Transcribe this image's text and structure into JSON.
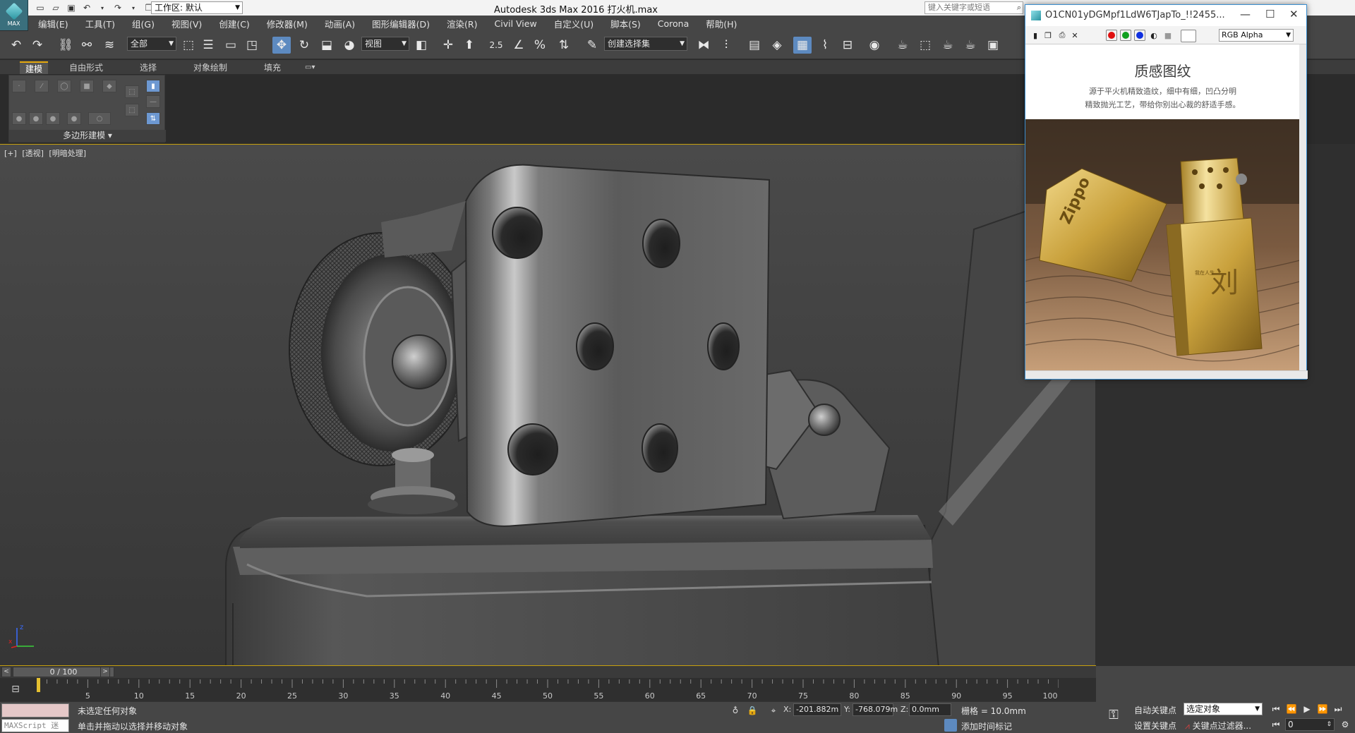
{
  "titlebar": {
    "app_logo_text": "MAX",
    "workspace": "工作区: 默认",
    "title": "Autodesk 3ds Max 2016      打火机.max",
    "search_placeholder": "键入关键字或短语"
  },
  "menu": [
    "编辑(E)",
    "工具(T)",
    "组(G)",
    "视图(V)",
    "创建(C)",
    "修改器(M)",
    "动画(A)",
    "图形编辑器(D)",
    "渲染(R)",
    "Civil View",
    "自定义(U)",
    "脚本(S)",
    "Corona",
    "帮助(H)"
  ],
  "toolbar": {
    "selection_filter": "全部",
    "ref_coord": "视图",
    "snap_angle_label": "2.5",
    "named_selection": "创建选择集"
  },
  "ribbon": {
    "tabs": [
      "建模",
      "自由形式",
      "选择",
      "对象绘制",
      "填充"
    ],
    "panel_label": "多边形建模"
  },
  "viewport": {
    "labels": [
      "[+]",
      "[透视]",
      "[明暗处理]"
    ],
    "gizmo_axes": [
      "z",
      "x"
    ]
  },
  "float_window": {
    "title": "O1CN01yDGMpf1LdW6TJapTo_!!2455...",
    "channel": "RGB Alpha",
    "heading": "质感图纹",
    "lines": [
      "源于平火机精致造纹，细中有细，凹凸分明",
      "精致抛光工艺，带给你别出心裁的舒适手感。"
    ],
    "brand_text": "Zippo",
    "engraved_char": "刘",
    "engraved_small": "我在人生"
  },
  "timeline": {
    "frame_display": "0 / 100",
    "ticks": [
      "5",
      "10",
      "15",
      "20",
      "25",
      "30",
      "35",
      "40",
      "45",
      "50",
      "55",
      "60",
      "65",
      "70",
      "75",
      "80",
      "85",
      "90",
      "95",
      "100"
    ]
  },
  "status": {
    "maxscript_label": "MAXScript 迷",
    "line1": "未选定任何对象",
    "line2": "单击并拖动以选择并移动对象",
    "x_label": "X:",
    "x_value": "-201.882m",
    "y_label": "Y:",
    "y_value": "-768.079m",
    "z_label": "Z:",
    "z_value": "0.0mm",
    "grid": "栅格 = 10.0mm",
    "add_tag": "添加时间标记"
  },
  "anim": {
    "auto_key": "自动关键点",
    "set_key": "设置关键点",
    "selected_dd": "选定对象",
    "key_filters": "关键点过滤器...",
    "frame_value": "0"
  }
}
